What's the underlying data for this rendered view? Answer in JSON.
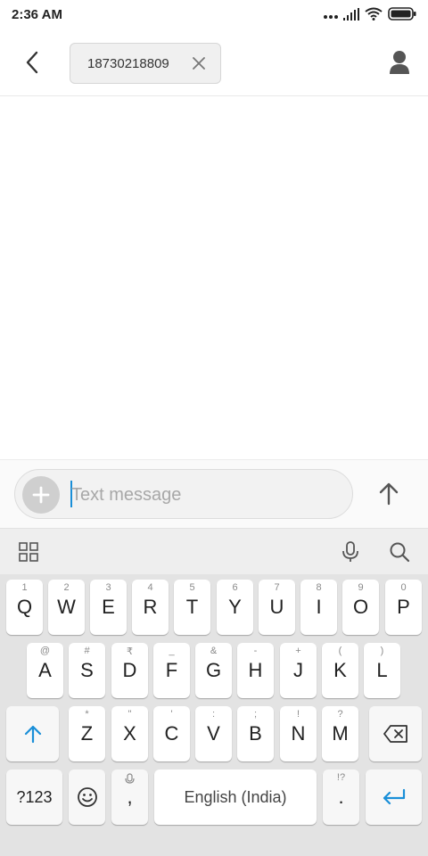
{
  "status_bar": {
    "time": "2:36 AM"
  },
  "header": {
    "recipient": "18730218809"
  },
  "composer": {
    "placeholder": "Text message"
  },
  "keyboard": {
    "row1": [
      {
        "letter": "Q",
        "hint": "1"
      },
      {
        "letter": "W",
        "hint": "2"
      },
      {
        "letter": "E",
        "hint": "3"
      },
      {
        "letter": "R",
        "hint": "4"
      },
      {
        "letter": "T",
        "hint": "5"
      },
      {
        "letter": "Y",
        "hint": "6"
      },
      {
        "letter": "U",
        "hint": "7"
      },
      {
        "letter": "I",
        "hint": "8"
      },
      {
        "letter": "O",
        "hint": "9"
      },
      {
        "letter": "P",
        "hint": "0"
      }
    ],
    "row2": [
      {
        "letter": "A",
        "hint": "@"
      },
      {
        "letter": "S",
        "hint": "#"
      },
      {
        "letter": "D",
        "hint": "₹"
      },
      {
        "letter": "F",
        "hint": "_"
      },
      {
        "letter": "G",
        "hint": "&"
      },
      {
        "letter": "H",
        "hint": "-"
      },
      {
        "letter": "J",
        "hint": "+"
      },
      {
        "letter": "K",
        "hint": "("
      },
      {
        "letter": "L",
        "hint": ")"
      }
    ],
    "row3": [
      {
        "letter": "Z",
        "hint": "*"
      },
      {
        "letter": "X",
        "hint": "\""
      },
      {
        "letter": "C",
        "hint": "'"
      },
      {
        "letter": "V",
        "hint": ":"
      },
      {
        "letter": "B",
        "hint": ";"
      },
      {
        "letter": "N",
        "hint": "!"
      },
      {
        "letter": "M",
        "hint": "?"
      }
    ],
    "symbols_key": "?123",
    "comma_key": ",",
    "space_label": "English (India)",
    "period_key": ".",
    "period_hint": "!?"
  },
  "colors": {
    "accent": "#1a8fd8",
    "icon_gray": "#555555"
  }
}
